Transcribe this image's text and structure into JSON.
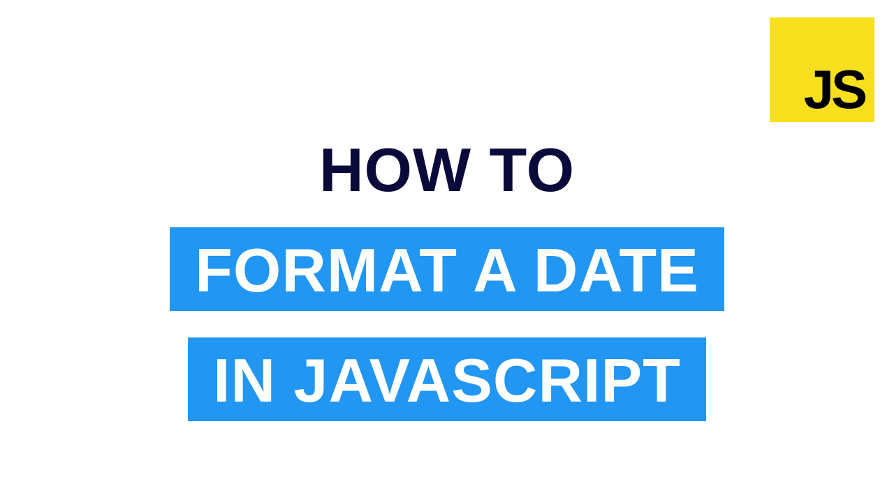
{
  "logo": {
    "text": "JS"
  },
  "title": {
    "line1": "HOW TO",
    "line2": "FORMAT A DATE",
    "line3": "IN JAVASCRIPT"
  },
  "colors": {
    "logo_bg": "#f7df1e",
    "highlight_bg": "#2196f3",
    "dark_text": "#0a0a3a"
  }
}
